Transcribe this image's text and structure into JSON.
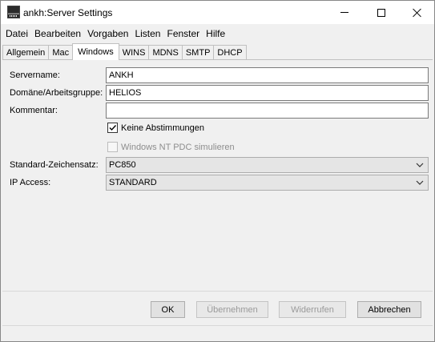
{
  "window": {
    "title": "ankh:Server Settings"
  },
  "menu": [
    "Datei",
    "Bearbeiten",
    "Vorgaben",
    "Listen",
    "Fenster",
    "Hilfe"
  ],
  "tabs": [
    "Allgemein",
    "Mac",
    "Windows",
    "WINS",
    "MDNS",
    "SMTP",
    "DHCP"
  ],
  "active_tab": "Windows",
  "form": {
    "servername": {
      "label": "Servername:",
      "value": "ANKH"
    },
    "domain": {
      "label": "Domäne/Arbeitsgruppe:",
      "value": "HELIOS"
    },
    "comment": {
      "label": "Kommentar:",
      "value": ""
    },
    "no_votes": {
      "label": "Keine Abstimmungen",
      "checked": true,
      "enabled": true
    },
    "nt_pdc": {
      "label": "Windows NT PDC simulieren",
      "checked": false,
      "enabled": false
    },
    "charset": {
      "label": "Standard-Zeichensatz:",
      "value": "PC850"
    },
    "ip_access": {
      "label": "IP Access:",
      "value": "STANDARD"
    }
  },
  "buttons": {
    "ok": "OK",
    "apply": "Übernehmen",
    "revert": "Widerrufen",
    "cancel": "Abbrechen"
  }
}
